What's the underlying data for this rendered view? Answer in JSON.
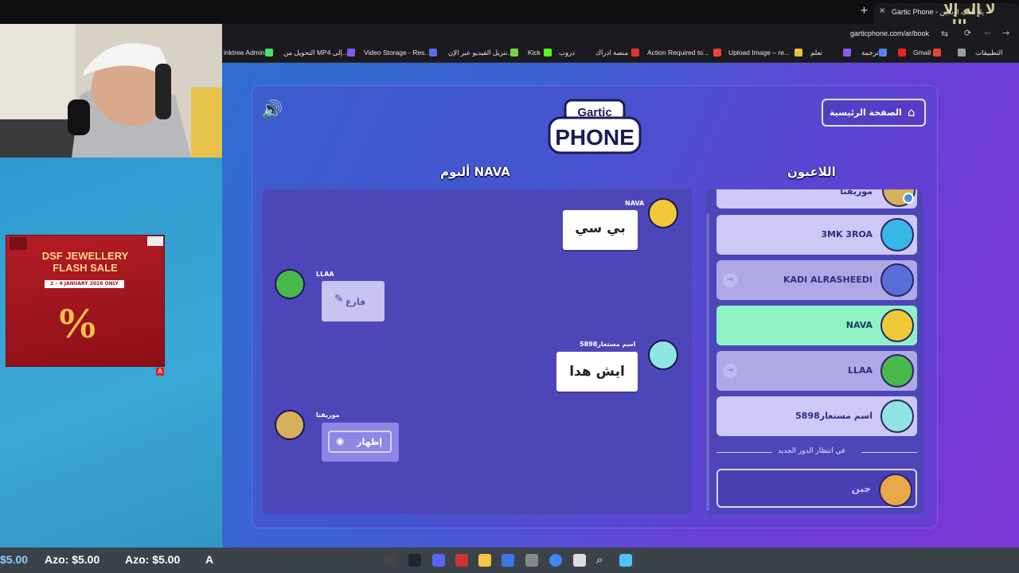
{
  "browser": {
    "tab_title": "Gartic Phone - يلا نلعب اونلاين",
    "new_tab_glyph": "+",
    "close_glyph": "×",
    "address": "garticphone.com/ar/book",
    "bookmarks": [
      "التطبيقات",
      "Gmail",
      "ترجمة",
      "تعلم",
      "Upload Image – re...",
      "Action Required to...",
      "منصة ادراك",
      "دروب",
      "Kick",
      "تنزيل الفيديو عبر الإن...",
      "Video Storage - Res...",
      "التحويل من MP4 إلى...",
      "inktree Admin"
    ]
  },
  "top_right_overlay": "لا إله إلا الله",
  "game": {
    "home_button": "الصفحة الرئيسية",
    "logo_top": "Gartic",
    "logo_bottom": "PHONE",
    "album_title": "ألبوم NAVA",
    "players_title": "اللاعبون",
    "album": [
      {
        "user": "NAVA",
        "text": "بي سي",
        "side": "right"
      },
      {
        "user": "LLAA",
        "text": "فارغ",
        "side": "left",
        "empty": true
      },
      {
        "user": "اسم مستعار5898",
        "text": "ايش هدا",
        "side": "right"
      },
      {
        "user": "موريقنا",
        "text": "إظهار",
        "side": "left",
        "reveal": true
      }
    ],
    "players": [
      {
        "name": "موريقنا",
        "state": "partial",
        "avatar_color": "#d6b05a"
      },
      {
        "name": "3MK 3ROA",
        "state": "normal",
        "avatar_color": "#38b8e8"
      },
      {
        "name": "KADI ALRASHEEDI",
        "state": "dim",
        "avatar_color": "#5a6ed8"
      },
      {
        "name": "NAVA",
        "state": "active",
        "avatar_color": "#f0c93a"
      },
      {
        "name": "LLAA",
        "state": "dim",
        "avatar_color": "#48b84a"
      },
      {
        "name": "اسم مستعار5898",
        "state": "normal",
        "avatar_color": "#8fe6e0"
      }
    ],
    "waiting_label": "في انتظار الدور الجديد",
    "waiting_player": "جبن"
  },
  "ad": {
    "title_line1": "DSF JEWELLERY",
    "title_line2": "FLASH SALE",
    "dates": "2 – 4 JANUARY 2026 ONLY",
    "percent": "%",
    "badge": "A"
  },
  "taskbar": {
    "money_left": "$5.00",
    "money_mid": "Azo: $5.00",
    "money_right": "Azo: $5.00",
    "letter": "A"
  }
}
